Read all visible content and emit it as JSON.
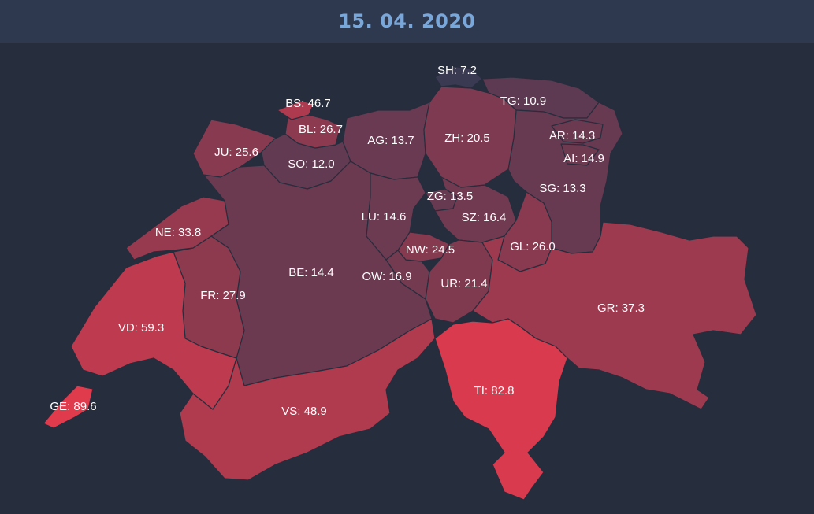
{
  "header": {
    "date": "15. 04. 2020"
  },
  "colors": {
    "background": "#262d3d",
    "header": "#2e384f",
    "date_text": "#7aa7da",
    "low": "#3a3a52",
    "high": "#e03a4d",
    "label": "#ffffff"
  },
  "cantons": [
    {
      "code": "GE",
      "value": 89.6,
      "label": "GE: 89.6"
    },
    {
      "code": "TI",
      "value": 82.8,
      "label": "TI: 82.8"
    },
    {
      "code": "VD",
      "value": 59.3,
      "label": "VD: 59.3"
    },
    {
      "code": "VS",
      "value": 48.9,
      "label": "VS: 48.9"
    },
    {
      "code": "BS",
      "value": 46.7,
      "label": "BS: 46.7"
    },
    {
      "code": "GR",
      "value": 37.3,
      "label": "GR: 37.3"
    },
    {
      "code": "NE",
      "value": 33.8,
      "label": "NE: 33.8"
    },
    {
      "code": "FR",
      "value": 27.9,
      "label": "FR: 27.9"
    },
    {
      "code": "BL",
      "value": 26.7,
      "label": "BL: 26.7"
    },
    {
      "code": "GL",
      "value": 26.0,
      "label": "GL: 26.0"
    },
    {
      "code": "JU",
      "value": 25.6,
      "label": "JU: 25.6"
    },
    {
      "code": "NW",
      "value": 24.5,
      "label": "NW: 24.5"
    },
    {
      "code": "UR",
      "value": 21.4,
      "label": "UR: 21.4"
    },
    {
      "code": "ZH",
      "value": 20.5,
      "label": "ZH: 20.5"
    },
    {
      "code": "OW",
      "value": 16.9,
      "label": "OW: 16.9"
    },
    {
      "code": "SZ",
      "value": 16.4,
      "label": "SZ: 16.4"
    },
    {
      "code": "AI",
      "value": 14.9,
      "label": "AI: 14.9"
    },
    {
      "code": "LU",
      "value": 14.6,
      "label": "LU: 14.6"
    },
    {
      "code": "BE",
      "value": 14.4,
      "label": "BE: 14.4"
    },
    {
      "code": "AR",
      "value": 14.3,
      "label": "AR: 14.3"
    },
    {
      "code": "AG",
      "value": 13.7,
      "label": "AG: 13.7"
    },
    {
      "code": "ZG",
      "value": 13.5,
      "label": "ZG: 13.5"
    },
    {
      "code": "SG",
      "value": 13.3,
      "label": "SG: 13.3"
    },
    {
      "code": "SO",
      "value": 12.0,
      "label": "SO: 12.0"
    },
    {
      "code": "TG",
      "value": 10.9,
      "label": "TG: 10.9"
    },
    {
      "code": "SH",
      "value": 7.2,
      "label": "SH: 7.2"
    }
  ]
}
